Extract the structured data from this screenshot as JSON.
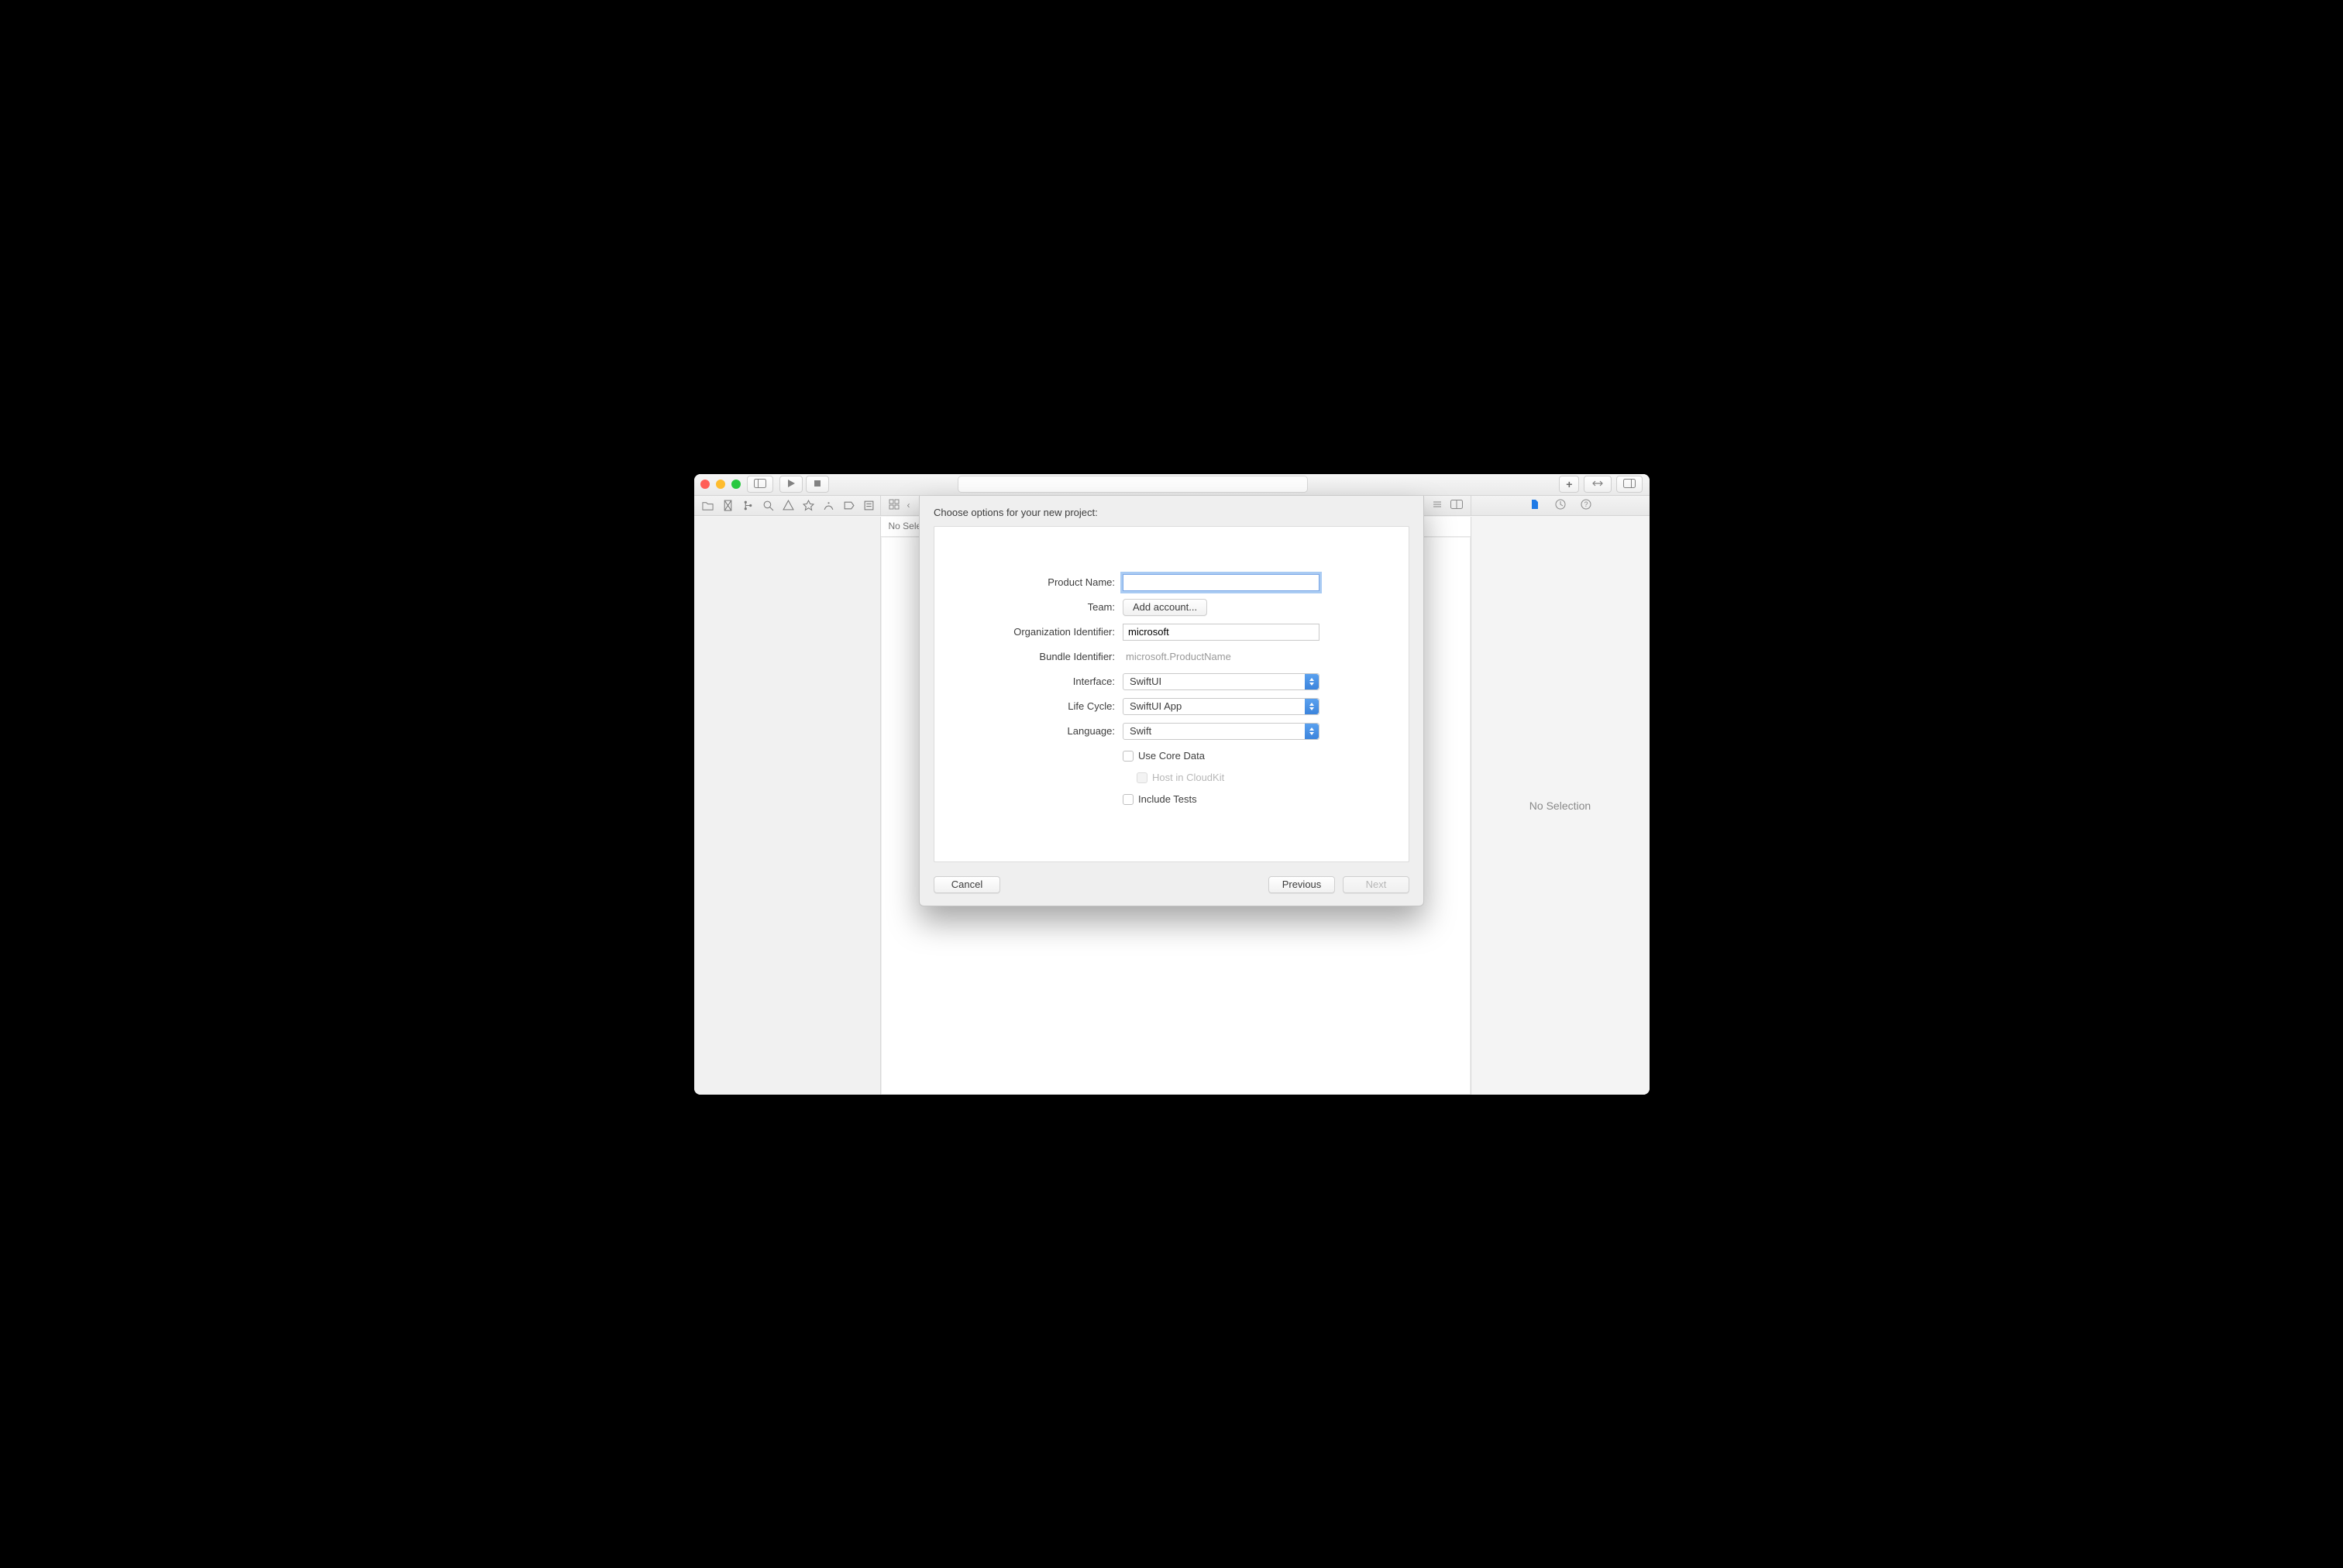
{
  "window": {
    "traffic": {
      "close": "close",
      "minimize": "minimize",
      "zoom": "zoom"
    }
  },
  "toolbar": {
    "sidebar_toggle_icon": "sidebar",
    "run_icon": "play",
    "stop_icon": "stop",
    "activity_field": "",
    "library_plus_icon": "plus",
    "code_review_icon": "compare",
    "panel_toggle_icon": "panels"
  },
  "navigator": {
    "tabs": [
      "project",
      "source-control",
      "symbols",
      "find",
      "issues",
      "tests",
      "debug",
      "breakpoints",
      "reports"
    ]
  },
  "editor_toolbar": {
    "back_icon": "chevron-left",
    "grid_icon": "grid",
    "split_icon": "split-editor"
  },
  "editor": {
    "header_text": "No Selection"
  },
  "inspector": {
    "tabs": [
      "file",
      "history",
      "help"
    ],
    "placeholder": "No Selection"
  },
  "sheet": {
    "title": "Choose options for your new project:",
    "fields": {
      "product_name": {
        "label": "Product Name:",
        "value": ""
      },
      "team": {
        "label": "Team:",
        "button": "Add account..."
      },
      "org_id": {
        "label": "Organization Identifier:",
        "value": "microsoft"
      },
      "bundle_id": {
        "label": "Bundle Identifier:",
        "value": "microsoft.ProductName"
      },
      "interface": {
        "label": "Interface:",
        "value": "SwiftUI"
      },
      "life_cycle": {
        "label": "Life Cycle:",
        "value": "SwiftUI App"
      },
      "language": {
        "label": "Language:",
        "value": "Swift"
      },
      "use_core_data": {
        "label": "Use Core Data",
        "checked": false
      },
      "host_cloudkit": {
        "label": "Host in CloudKit",
        "checked": false,
        "disabled": true
      },
      "include_tests": {
        "label": "Include Tests",
        "checked": false
      }
    },
    "buttons": {
      "cancel": "Cancel",
      "previous": "Previous",
      "next": "Next"
    }
  }
}
